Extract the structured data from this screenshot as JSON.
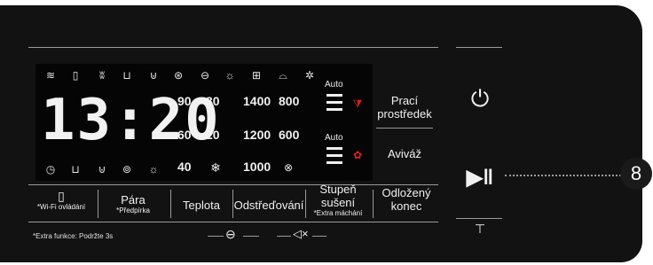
{
  "display": {
    "time": "13:20",
    "spin_values": [
      "1400",
      "800",
      "1200",
      "600",
      "1000"
    ],
    "temp_values": [
      "90",
      "30",
      "60",
      "20",
      "40"
    ],
    "auto_label_top": "Auto",
    "auto_label_bottom": "Auto",
    "top_icons": [
      "wifi-icon",
      "phone-icon",
      "steam-icon",
      "tub-icon",
      "prewash-icon",
      "lock-icon",
      "eye-icon",
      "sun-icon",
      "shirt-iron-icon",
      "iron-icon",
      "fan-icon"
    ],
    "bottom_icons": [
      "clock-icon",
      "tub-low-icon",
      "tub-mid-icon",
      "tub-high-icon",
      "sun-icon"
    ]
  },
  "side_labels": {
    "detergent": "Prací prostředek",
    "softener": "Aviváž"
  },
  "buttons": [
    {
      "label": "",
      "sub": "*Wi-Fi ovládání"
    },
    {
      "label": "Pára",
      "sub": "*Předpírka"
    },
    {
      "label": "Teplota",
      "sub": ""
    },
    {
      "label": "Odstřeďování",
      "sub": ""
    },
    {
      "label": "Stupeň sušení",
      "sub": "*Extra máchání"
    },
    {
      "label": "Odložený konec",
      "sub": ""
    }
  ],
  "extra_note": "*Extra funkce: Podržte 3s",
  "badge": "8",
  "colors": {
    "panel": "#121212",
    "accent_red": "#e02020",
    "text": "#f0f0f0"
  }
}
